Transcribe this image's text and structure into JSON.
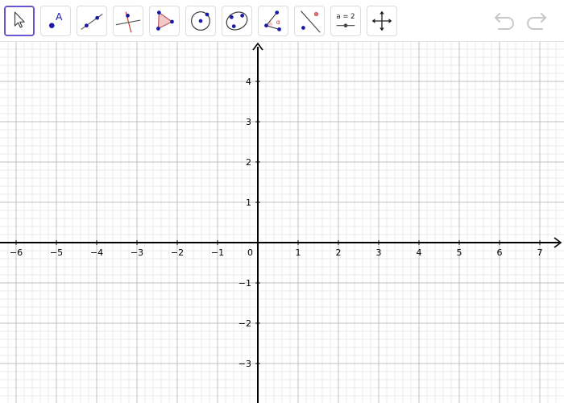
{
  "toolbar": {
    "tools": [
      {
        "name": "move-tool",
        "icon": "arrow-cursor-icon",
        "active": true
      },
      {
        "name": "point-tool",
        "icon": "point-icon",
        "label": "A"
      },
      {
        "name": "line-tool",
        "icon": "line-through-points-icon"
      },
      {
        "name": "perpendicular-line-tool",
        "icon": "perpendicular-line-icon"
      },
      {
        "name": "polygon-tool",
        "icon": "polygon-icon"
      },
      {
        "name": "circle-center-point-tool",
        "icon": "circle-center-point-icon"
      },
      {
        "name": "conic-five-points-tool",
        "icon": "ellipse-points-icon"
      },
      {
        "name": "angle-tool",
        "icon": "angle-icon",
        "label": "α"
      },
      {
        "name": "reflect-tool",
        "icon": "reflect-about-line-icon"
      },
      {
        "name": "slider-tool",
        "icon": "slider-icon",
        "label": "a = 2"
      },
      {
        "name": "move-graphics-view-tool",
        "icon": "move-arrows-icon"
      }
    ],
    "undo_icon": "undo-icon",
    "redo_icon": "redo-icon"
  },
  "colors": {
    "accent": "#6557d2",
    "point": "#1a1aa6",
    "axis": "#000000",
    "major_grid": "#c0c0c0",
    "minor_grid": "#ebebeb",
    "polygon_fill": "#f3c8c8",
    "polygon_edge": "#b45050",
    "red_line": "#c0392b",
    "undo_disabled": "#c8c8c8"
  },
  "graph": {
    "origin_label": "0",
    "x_labels": [
      "−6",
      "−5",
      "−4",
      "−3",
      "−2",
      "−1",
      "1",
      "2",
      "3",
      "4",
      "5",
      "6",
      "7"
    ],
    "y_labels": [
      "4",
      "3",
      "2",
      "1",
      "−1",
      "−2",
      "−3"
    ]
  }
}
